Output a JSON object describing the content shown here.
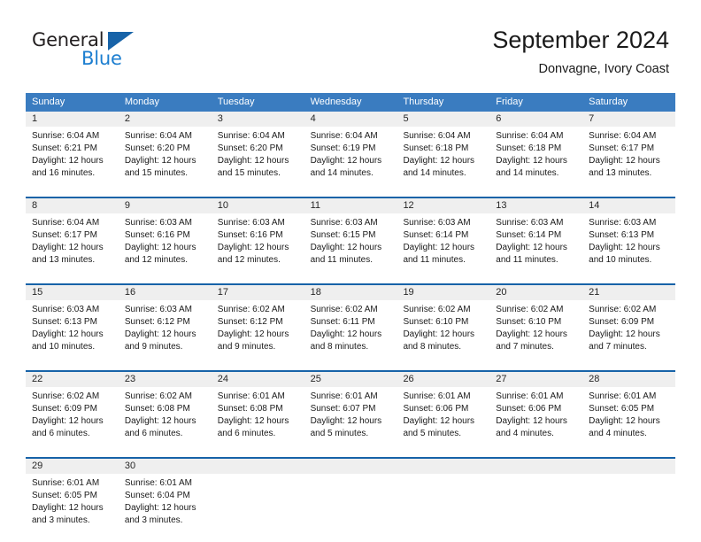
{
  "logo": {
    "general_text": "General",
    "blue_text": "Blue",
    "triangle": "triangle-shape"
  },
  "header": {
    "title": "September 2024",
    "subtitle": "Donvagne, Ivory Coast"
  },
  "colors": {
    "header_blue": "#3a7cc0",
    "row_divider_blue": "#1763a8",
    "day_band_gray": "#efefef",
    "logo_blue": "#1c7ed0"
  },
  "weekdays": [
    "Sunday",
    "Monday",
    "Tuesday",
    "Wednesday",
    "Thursday",
    "Friday",
    "Saturday"
  ],
  "weeks": [
    [
      {
        "day": "1",
        "sunrise": "Sunrise: 6:04 AM",
        "sunset": "Sunset: 6:21 PM",
        "daylight1": "Daylight: 12 hours",
        "daylight2": "and 16 minutes."
      },
      {
        "day": "2",
        "sunrise": "Sunrise: 6:04 AM",
        "sunset": "Sunset: 6:20 PM",
        "daylight1": "Daylight: 12 hours",
        "daylight2": "and 15 minutes."
      },
      {
        "day": "3",
        "sunrise": "Sunrise: 6:04 AM",
        "sunset": "Sunset: 6:20 PM",
        "daylight1": "Daylight: 12 hours",
        "daylight2": "and 15 minutes."
      },
      {
        "day": "4",
        "sunrise": "Sunrise: 6:04 AM",
        "sunset": "Sunset: 6:19 PM",
        "daylight1": "Daylight: 12 hours",
        "daylight2": "and 14 minutes."
      },
      {
        "day": "5",
        "sunrise": "Sunrise: 6:04 AM",
        "sunset": "Sunset: 6:18 PM",
        "daylight1": "Daylight: 12 hours",
        "daylight2": "and 14 minutes."
      },
      {
        "day": "6",
        "sunrise": "Sunrise: 6:04 AM",
        "sunset": "Sunset: 6:18 PM",
        "daylight1": "Daylight: 12 hours",
        "daylight2": "and 14 minutes."
      },
      {
        "day": "7",
        "sunrise": "Sunrise: 6:04 AM",
        "sunset": "Sunset: 6:17 PM",
        "daylight1": "Daylight: 12 hours",
        "daylight2": "and 13 minutes."
      }
    ],
    [
      {
        "day": "8",
        "sunrise": "Sunrise: 6:04 AM",
        "sunset": "Sunset: 6:17 PM",
        "daylight1": "Daylight: 12 hours",
        "daylight2": "and 13 minutes."
      },
      {
        "day": "9",
        "sunrise": "Sunrise: 6:03 AM",
        "sunset": "Sunset: 6:16 PM",
        "daylight1": "Daylight: 12 hours",
        "daylight2": "and 12 minutes."
      },
      {
        "day": "10",
        "sunrise": "Sunrise: 6:03 AM",
        "sunset": "Sunset: 6:16 PM",
        "daylight1": "Daylight: 12 hours",
        "daylight2": "and 12 minutes."
      },
      {
        "day": "11",
        "sunrise": "Sunrise: 6:03 AM",
        "sunset": "Sunset: 6:15 PM",
        "daylight1": "Daylight: 12 hours",
        "daylight2": "and 11 minutes."
      },
      {
        "day": "12",
        "sunrise": "Sunrise: 6:03 AM",
        "sunset": "Sunset: 6:14 PM",
        "daylight1": "Daylight: 12 hours",
        "daylight2": "and 11 minutes."
      },
      {
        "day": "13",
        "sunrise": "Sunrise: 6:03 AM",
        "sunset": "Sunset: 6:14 PM",
        "daylight1": "Daylight: 12 hours",
        "daylight2": "and 11 minutes."
      },
      {
        "day": "14",
        "sunrise": "Sunrise: 6:03 AM",
        "sunset": "Sunset: 6:13 PM",
        "daylight1": "Daylight: 12 hours",
        "daylight2": "and 10 minutes."
      }
    ],
    [
      {
        "day": "15",
        "sunrise": "Sunrise: 6:03 AM",
        "sunset": "Sunset: 6:13 PM",
        "daylight1": "Daylight: 12 hours",
        "daylight2": "and 10 minutes."
      },
      {
        "day": "16",
        "sunrise": "Sunrise: 6:03 AM",
        "sunset": "Sunset: 6:12 PM",
        "daylight1": "Daylight: 12 hours",
        "daylight2": "and 9 minutes."
      },
      {
        "day": "17",
        "sunrise": "Sunrise: 6:02 AM",
        "sunset": "Sunset: 6:12 PM",
        "daylight1": "Daylight: 12 hours",
        "daylight2": "and 9 minutes."
      },
      {
        "day": "18",
        "sunrise": "Sunrise: 6:02 AM",
        "sunset": "Sunset: 6:11 PM",
        "daylight1": "Daylight: 12 hours",
        "daylight2": "and 8 minutes."
      },
      {
        "day": "19",
        "sunrise": "Sunrise: 6:02 AM",
        "sunset": "Sunset: 6:10 PM",
        "daylight1": "Daylight: 12 hours",
        "daylight2": "and 8 minutes."
      },
      {
        "day": "20",
        "sunrise": "Sunrise: 6:02 AM",
        "sunset": "Sunset: 6:10 PM",
        "daylight1": "Daylight: 12 hours",
        "daylight2": "and 7 minutes."
      },
      {
        "day": "21",
        "sunrise": "Sunrise: 6:02 AM",
        "sunset": "Sunset: 6:09 PM",
        "daylight1": "Daylight: 12 hours",
        "daylight2": "and 7 minutes."
      }
    ],
    [
      {
        "day": "22",
        "sunrise": "Sunrise: 6:02 AM",
        "sunset": "Sunset: 6:09 PM",
        "daylight1": "Daylight: 12 hours",
        "daylight2": "and 6 minutes."
      },
      {
        "day": "23",
        "sunrise": "Sunrise: 6:02 AM",
        "sunset": "Sunset: 6:08 PM",
        "daylight1": "Daylight: 12 hours",
        "daylight2": "and 6 minutes."
      },
      {
        "day": "24",
        "sunrise": "Sunrise: 6:01 AM",
        "sunset": "Sunset: 6:08 PM",
        "daylight1": "Daylight: 12 hours",
        "daylight2": "and 6 minutes."
      },
      {
        "day": "25",
        "sunrise": "Sunrise: 6:01 AM",
        "sunset": "Sunset: 6:07 PM",
        "daylight1": "Daylight: 12 hours",
        "daylight2": "and 5 minutes."
      },
      {
        "day": "26",
        "sunrise": "Sunrise: 6:01 AM",
        "sunset": "Sunset: 6:06 PM",
        "daylight1": "Daylight: 12 hours",
        "daylight2": "and 5 minutes."
      },
      {
        "day": "27",
        "sunrise": "Sunrise: 6:01 AM",
        "sunset": "Sunset: 6:06 PM",
        "daylight1": "Daylight: 12 hours",
        "daylight2": "and 4 minutes."
      },
      {
        "day": "28",
        "sunrise": "Sunrise: 6:01 AM",
        "sunset": "Sunset: 6:05 PM",
        "daylight1": "Daylight: 12 hours",
        "daylight2": "and 4 minutes."
      }
    ],
    [
      {
        "day": "29",
        "sunrise": "Sunrise: 6:01 AM",
        "sunset": "Sunset: 6:05 PM",
        "daylight1": "Daylight: 12 hours",
        "daylight2": "and 3 minutes."
      },
      {
        "day": "30",
        "sunrise": "Sunrise: 6:01 AM",
        "sunset": "Sunset: 6:04 PM",
        "daylight1": "Daylight: 12 hours",
        "daylight2": "and 3 minutes."
      },
      {
        "day": "",
        "sunrise": "",
        "sunset": "",
        "daylight1": "",
        "daylight2": ""
      },
      {
        "day": "",
        "sunrise": "",
        "sunset": "",
        "daylight1": "",
        "daylight2": ""
      },
      {
        "day": "",
        "sunrise": "",
        "sunset": "",
        "daylight1": "",
        "daylight2": ""
      },
      {
        "day": "",
        "sunrise": "",
        "sunset": "",
        "daylight1": "",
        "daylight2": ""
      },
      {
        "day": "",
        "sunrise": "",
        "sunset": "",
        "daylight1": "",
        "daylight2": ""
      }
    ]
  ]
}
